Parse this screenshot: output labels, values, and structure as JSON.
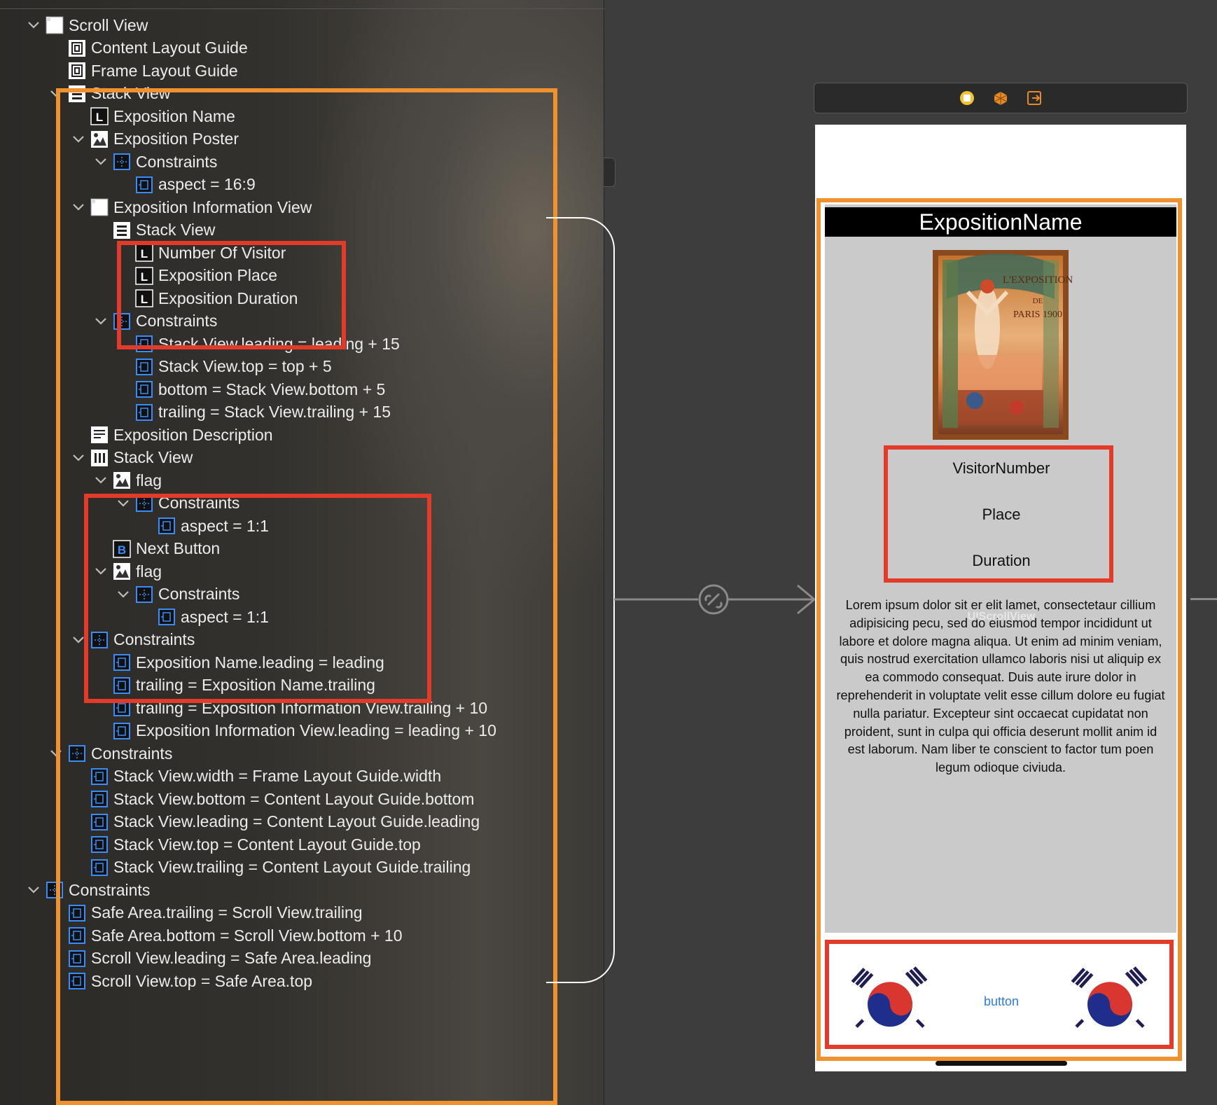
{
  "outline": {
    "rows": [
      {
        "label": "Scroll View"
      },
      {
        "label": "Content Layout Guide"
      },
      {
        "label": "Frame Layout Guide"
      },
      {
        "label": "Stack View"
      },
      {
        "label": "Exposition Name"
      },
      {
        "label": "Exposition Poster"
      },
      {
        "label": "Constraints"
      },
      {
        "label": "aspect = 16:9"
      },
      {
        "label": "Exposition Information View"
      },
      {
        "label": "Stack View"
      },
      {
        "label": "Number Of Visitor"
      },
      {
        "label": "Exposition Place"
      },
      {
        "label": "Exposition Duration"
      },
      {
        "label": "Constraints"
      },
      {
        "label": "Stack View.leading = leading + 15"
      },
      {
        "label": "Stack View.top = top + 5"
      },
      {
        "label": "bottom = Stack View.bottom + 5"
      },
      {
        "label": "trailing = Stack View.trailing + 15"
      },
      {
        "label": "Exposition Description"
      },
      {
        "label": "Stack View"
      },
      {
        "label": "flag"
      },
      {
        "label": "Constraints"
      },
      {
        "label": "aspect = 1:1"
      },
      {
        "label": "Next Button"
      },
      {
        "label": "flag"
      },
      {
        "label": "Constraints"
      },
      {
        "label": "aspect = 1:1"
      },
      {
        "label": "Constraints"
      },
      {
        "label": "Exposition Name.leading = leading"
      },
      {
        "label": "trailing = Exposition Name.trailing"
      },
      {
        "label": "trailing = Exposition Information View.trailing + 10"
      },
      {
        "label": "Exposition Information View.leading = leading + 10"
      },
      {
        "label": "Constraints"
      },
      {
        "label": "Stack View.width = Frame Layout Guide.width"
      },
      {
        "label": "Stack View.bottom = Content Layout Guide.bottom"
      },
      {
        "label": "Stack View.leading = Content Layout Guide.leading"
      },
      {
        "label": "Stack View.top = Content Layout Guide.top"
      },
      {
        "label": "Stack View.trailing = Content Layout Guide.trailing"
      },
      {
        "label": "Constraints"
      },
      {
        "label": "Safe Area.trailing = Scroll View.trailing"
      },
      {
        "label": "Safe Area.bottom = Scroll View.bottom + 10"
      },
      {
        "label": "Scroll View.leading = Safe Area.leading"
      },
      {
        "label": "Scroll View.top = Safe Area.top"
      }
    ]
  },
  "preview": {
    "title": "ExpositionName",
    "poster": {
      "line1": "L'EXPOSITION",
      "line2": "DE",
      "line3": "PARIS 1900"
    },
    "visitor_number": "VisitorNumber",
    "place": "Place",
    "duration": "Duration",
    "description_lines": [
      "Lorem ipsum dolor sit er elit lamet, consectetaur cillium",
      "adipisicing pecu, sed do eiusmod tempor incididunt ut",
      "labore et dolore magna aliqua. Ut enim ad minim veniam,",
      "quis nostrud exercitation ullamco laboris nisi ut aliquip ex",
      "ea commodo consequat. Duis aute irure dolor in",
      "reprehenderit in voluptate velit esse cillum dolore eu fugiat",
      "nulla pariatur. Excepteur sint occaecat cupidatat non",
      "proident, sunt in culpa qui officia deserunt mollit anim id",
      "est laborum. Nam liber te conscient to factor tum poen",
      "legum odioque civiuda."
    ],
    "ghost_label": "UIScrollView",
    "button_label": "button"
  },
  "colors": {
    "highlight_orange": "#f0912f",
    "highlight_red": "#e23b2a",
    "button_blue": "#2f7bd9"
  }
}
